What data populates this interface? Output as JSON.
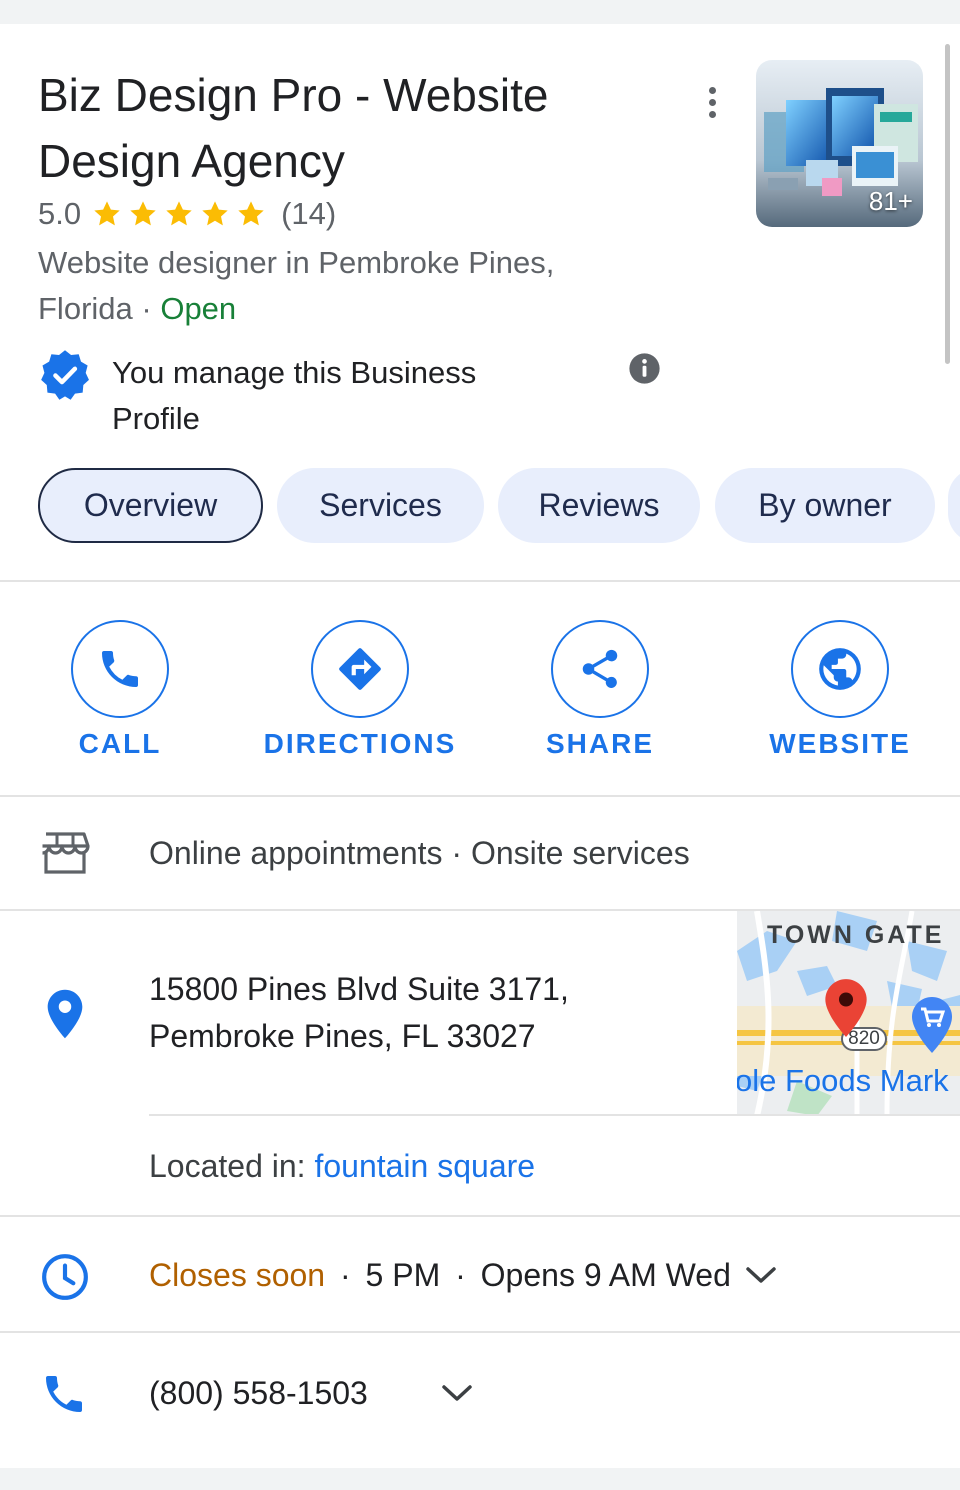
{
  "business": {
    "name": "Biz Design Pro - Website Design Agency",
    "rating": "5.0",
    "review_count": "(14)",
    "category_line": "Website designer in Pembroke Pines, Florida",
    "separator": " · ",
    "status": "Open",
    "photo_count": "81+",
    "stars": 5
  },
  "manage": {
    "text": "You manage this Business Profile"
  },
  "tabs": [
    {
      "label": "Overview",
      "active": true
    },
    {
      "label": "Services"
    },
    {
      "label": "Reviews"
    },
    {
      "label": "By owner"
    }
  ],
  "actions": [
    {
      "label": "CALL",
      "icon": "phone-icon"
    },
    {
      "label": "DIRECTIONS",
      "icon": "directions-icon"
    },
    {
      "label": "SHARE",
      "icon": "share-icon"
    },
    {
      "label": "WEBSITE",
      "icon": "globe-icon"
    }
  ],
  "service_options": {
    "text": "Online appointments · Onsite services",
    "icon": "storefront-icon"
  },
  "address": {
    "line1": "15800 Pines Blvd Suite 3171,",
    "line2": "Pembroke Pines, FL 33027",
    "icon": "location-pin-icon",
    "located_in_label": "Located in: ",
    "located_in_link": "fountain square"
  },
  "map": {
    "area_label": "TOWN GATE",
    "route_label": "820",
    "poi_label": "ole Foods Mark"
  },
  "hours": {
    "status": "Closes soon",
    "close_time": "5 PM",
    "next_open": "Opens 9 AM Wed",
    "dot": "·",
    "icon": "clock-icon"
  },
  "phone": {
    "number": "(800) 558-1503",
    "icon": "phone-icon"
  },
  "colors": {
    "accent": "#1a73e8",
    "open": "#188038",
    "closes_soon": "#b06000",
    "star": "#fbbc04",
    "tab_bg": "#e8eefc"
  }
}
